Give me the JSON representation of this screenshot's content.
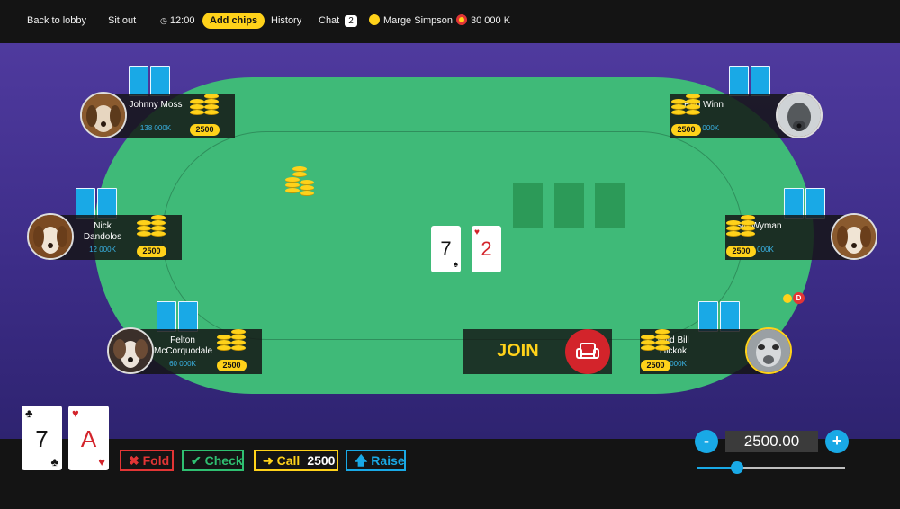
{
  "topbar": {
    "back_label": "Back to lobby",
    "sit_out_label": "Sit out",
    "time": "12:00",
    "add_chips_label": "Add chips",
    "history_label": "History",
    "chat_label": "Chat",
    "chat_count": "2",
    "user_name": "Marge Simpson",
    "balance": "30 000 K",
    "colors": {
      "accent": "#ffd21a",
      "background": "#141414"
    }
  },
  "seats": [
    {
      "name": "Johnny Moss",
      "chips": "138 000K",
      "stake": "2500",
      "icon": "dog-avatar"
    },
    {
      "name": "Nick Dandolos",
      "chips": "12 000K",
      "stake": "2500",
      "icon": "dog-avatar"
    },
    {
      "name": "Felton McCorquodale",
      "chips": "60 000K",
      "stake": "2500",
      "icon": "dog-avatar"
    },
    {
      "name": "Red Winn",
      "chips": "260 000K",
      "stake": "2500",
      "icon": "dog-avatar"
    },
    {
      "name": "Sid Wyman",
      "chips": "115 000K",
      "stake": "2500",
      "icon": "dog-avatar"
    },
    {
      "name": "Wild Bill Hickok",
      "chips": "25 000K",
      "stake": "2500",
      "icon": "dog-avatar"
    }
  ],
  "dealer_label": "D",
  "board": {
    "cards": [
      {
        "rank": "7",
        "suit": "♠",
        "color": "#141414"
      },
      {
        "rank": "2",
        "suit": "♥",
        "color": "#d3242b"
      }
    ],
    "empty_slots": 3
  },
  "hand": {
    "cards": [
      {
        "rank": "7",
        "suit": "♣",
        "color": "#141414"
      },
      {
        "rank": "A",
        "suit": "♥",
        "color": "#d3242b"
      }
    ]
  },
  "join_label": "JOIN",
  "actions": {
    "fold_label": "Fold",
    "check_label": "Check",
    "call_label": "Call",
    "call_amount": "2500",
    "raise_label": "Raise"
  },
  "bet": {
    "value": "2500.00",
    "minus": "-",
    "plus": "+",
    "slider_fraction": 0.27
  },
  "colors": {
    "felt": "#3fba78",
    "room": "#4f3a9e",
    "fold": "#e23535",
    "check": "#2fbf71",
    "call": "#ffd21a",
    "raise": "#19a9e6"
  }
}
